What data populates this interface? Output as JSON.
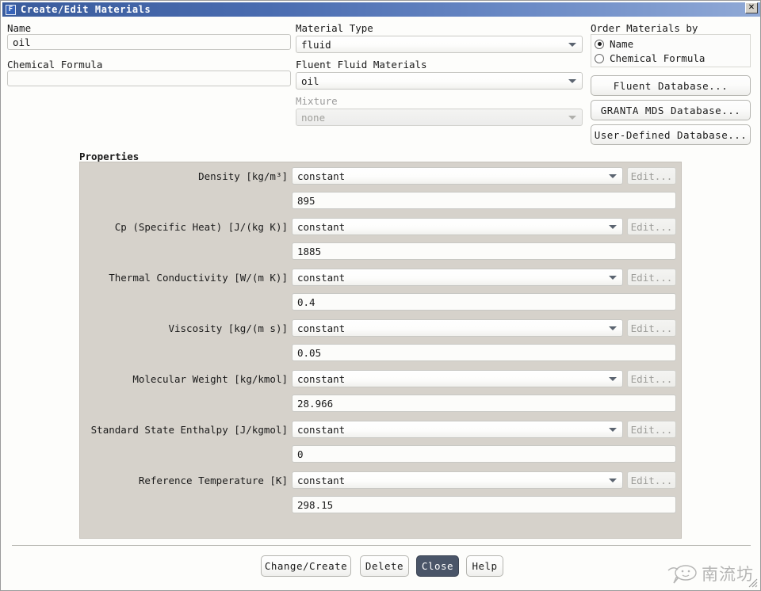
{
  "window": {
    "title": "Create/Edit Materials",
    "icon": "fluent-f-icon",
    "close_label": "✕"
  },
  "identity": {
    "name_label": "Name",
    "name_value": "oil",
    "formula_label": "Chemical Formula",
    "formula_value": "",
    "formula_placeholder": ""
  },
  "type": {
    "material_type_label": "Material Type",
    "material_type_value": "fluid",
    "fluent_materials_label": "Fluent Fluid Materials",
    "fluent_materials_value": "oil",
    "mixture_label": "Mixture",
    "mixture_value": "none"
  },
  "order": {
    "title": "Order Materials by",
    "options": [
      {
        "label": "Name",
        "selected": true
      },
      {
        "label": "Chemical Formula",
        "selected": false
      }
    ],
    "buttons": [
      "Fluent Database...",
      "GRANTA MDS Database...",
      "User-Defined Database..."
    ]
  },
  "properties": {
    "title": "Properties",
    "edit_label": "Edit...",
    "rows": [
      {
        "label": "Density [kg/m³]",
        "method": "constant",
        "value": "895"
      },
      {
        "label": "Cp (Specific Heat) [J/(kg K)]",
        "method": "constant",
        "value": "1885"
      },
      {
        "label": "Thermal Conductivity [W/(m K)]",
        "method": "constant",
        "value": "0.4"
      },
      {
        "label": "Viscosity [kg/(m s)]",
        "method": "constant",
        "value": "0.05"
      },
      {
        "label": "Molecular Weight [kg/kmol]",
        "method": "constant",
        "value": "28.966"
      },
      {
        "label": "Standard State Enthalpy [J/kgmol]",
        "method": "constant",
        "value": "0"
      },
      {
        "label": "Reference Temperature [K]",
        "method": "constant",
        "value": "298.15"
      }
    ]
  },
  "footer": {
    "buttons": [
      {
        "label": "Change/Create",
        "primary": false
      },
      {
        "label": "Delete",
        "primary": false
      },
      {
        "label": "Close",
        "primary": true
      },
      {
        "label": "Help",
        "primary": false
      }
    ]
  },
  "watermark": {
    "text": "南流坊"
  },
  "colors": {
    "titlebar_start": "#3a5c9c",
    "titlebar_end": "#90a9d6",
    "panel_bg": "#d6d2cb",
    "primary_button": "#4a5568"
  }
}
